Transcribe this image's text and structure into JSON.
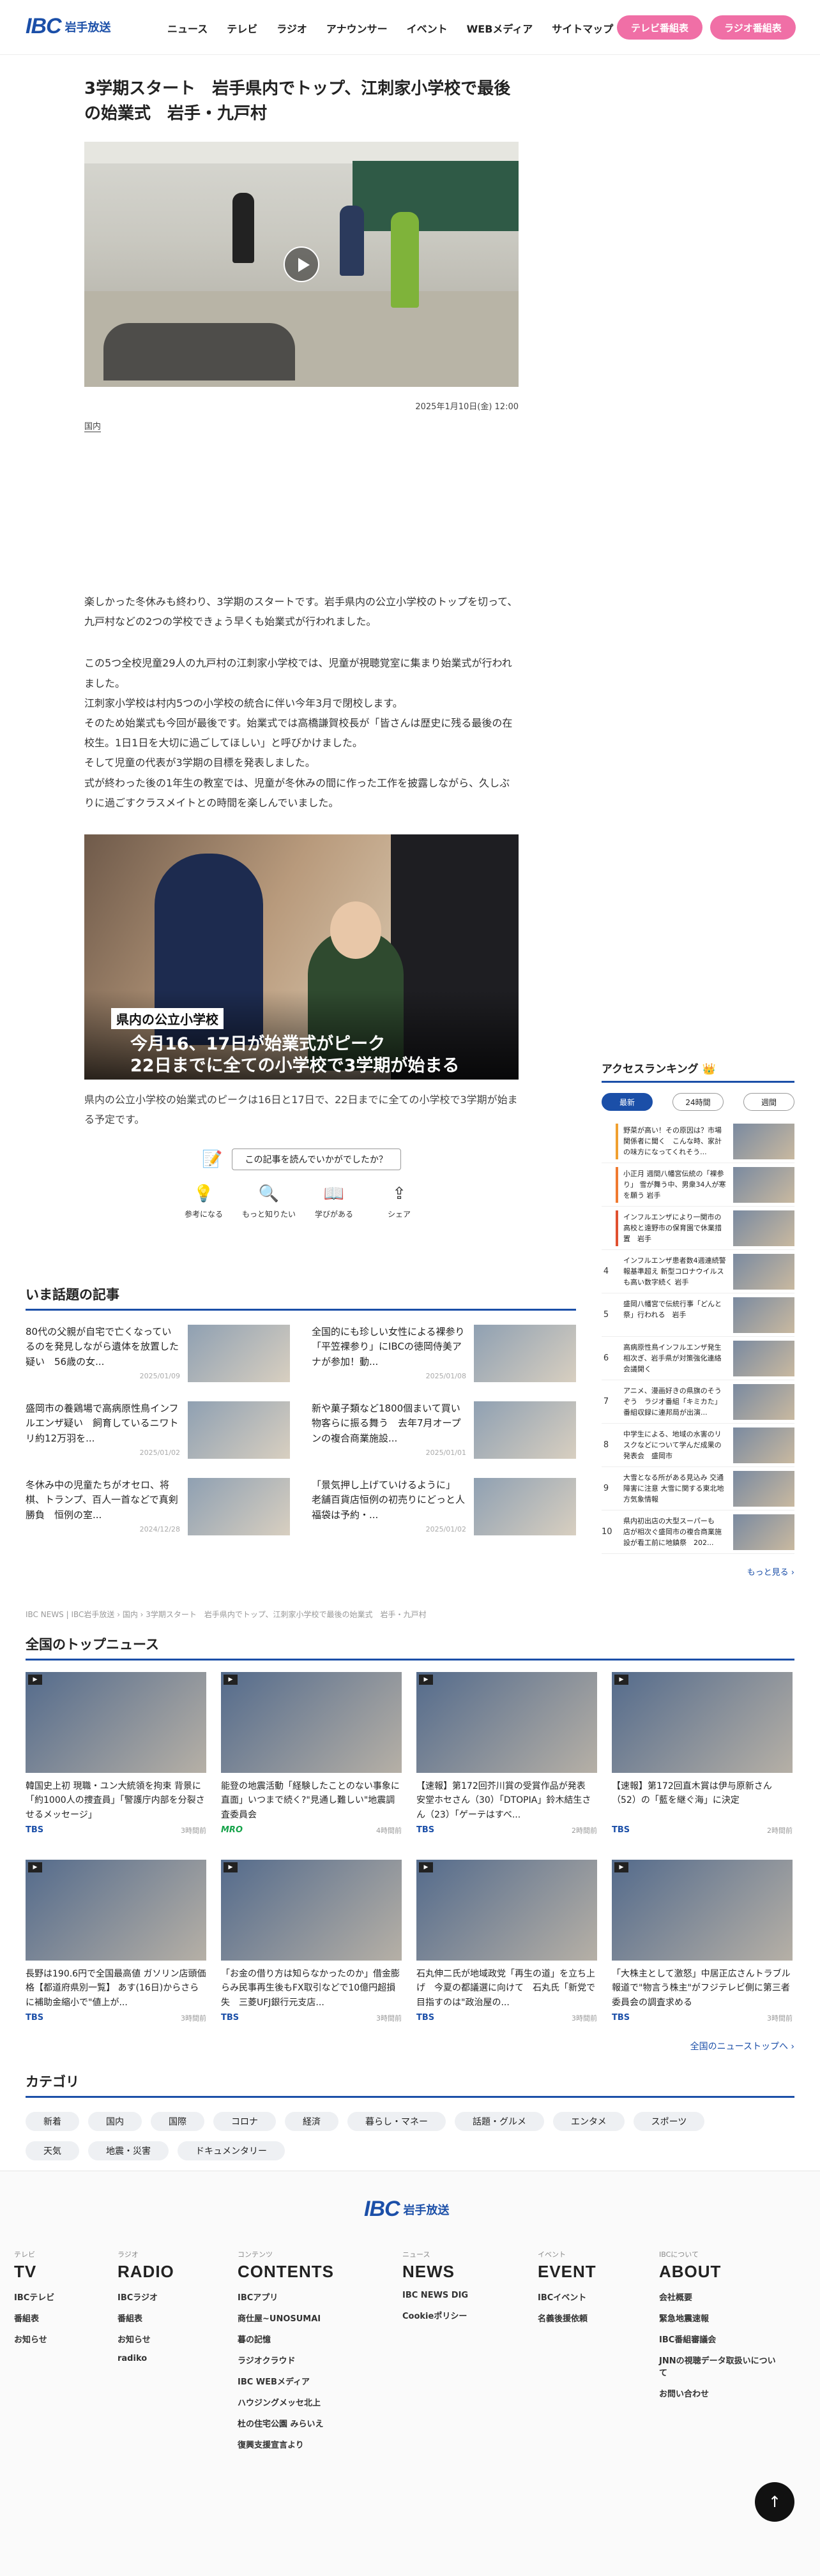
{
  "header": {
    "logo_mark": "IBC",
    "logo_text": "岩手放送",
    "nav": [
      "ニュース",
      "テレビ",
      "ラジオ",
      "アナウンサー",
      "イベント",
      "WEBメディア",
      "サイトマップ"
    ],
    "tv_button": "テレビ番組表",
    "radio_button": "ラジオ番組表"
  },
  "article": {
    "title": "3学期スタート　岩手県内でトップ、江刺家小学校で最後の始業式　岩手・九戸村",
    "date": "2025年1月10日(金) 12:00",
    "category": "国内",
    "paragraphs": [
      "楽しかった冬休みも終わり、3学期のスタートです。岩手県内の公立小学校のトップを切って、九戸村などの2つの学校できょう早くも始業式が行われました。",
      "この5つ全校児童29人の九戸村の江刺家小学校では、児童が視聴覚室に集まり始業式が行われました。\n江刺家小学校は村内5つの小学校の統合に伴い今年3月で閉校します。\nそのため始業式も今回が最後です。始業式では高橋謙賀校長が「皆さんは歴史に残る最後の在校生。1日1日を大切に過ごしてほしい」と呼びかけました。\nそして児童の代表が3学期の目標を発表しました。\n式が終わった後の1年生の教室では、児童が冬休みの間に作った工作を披露しながら、久しぶりに過ごすクラスメイトとの時間を楽しんでいました。"
    ],
    "figure_tag": "県内の公立小学校",
    "figure_line1": "今月16、17日が始業式がピーク",
    "figure_line2": "22日までに全ての小学校で3学期が始まる",
    "figure_caption": "県内の公立小学校の始業式のピークは16日と17日で、22日までに全ての小学校で3学期が始まる予定です。"
  },
  "feedback": {
    "question": "この記事を読んでいかがでしたか？",
    "reactions": [
      {
        "icon": "💡",
        "label": "参考になる"
      },
      {
        "icon": "🔍",
        "label": "もっと知りたい"
      },
      {
        "icon": "📖",
        "label": "学びがある"
      },
      {
        "icon": "⇪",
        "label": "シェア"
      }
    ]
  },
  "ranking": {
    "heading": "アクセスランキング 👑",
    "tabs": [
      "最新",
      "24時間",
      "週間"
    ],
    "items": [
      {
        "num": "",
        "color": "#f0a030",
        "text": "野菜が高い！その原因は？市場関係者に聞く　こんな時、家計の味方になってくれそう..."
      },
      {
        "num": "",
        "color": "#f07a30",
        "text": "小正月 週間八幡宮伝統の「裸参り」 雪が舞う中、男衆34人が寒を願う 岩手"
      },
      {
        "num": "",
        "color": "#e05030",
        "text": "インフルエンザにより一関市の高校と遠野市の保育園で休業措置　岩手"
      },
      {
        "num": "4",
        "color": "#fff",
        "text": "インフルエンザ患者数4週連続警報基準超え 新型コロナウイルスも高い数字続く 岩手"
      },
      {
        "num": "5",
        "color": "#fff",
        "text": "盛岡八幡宮で伝統行事「どんと祭」行われる　岩手"
      },
      {
        "num": "6",
        "color": "#fff",
        "text": "高病原性鳥インフルエンザ発生相次ぎ、岩手県が対策強化連絡会議開く"
      },
      {
        "num": "7",
        "color": "#fff",
        "text": "アニメ、漫画好きの県旗のそうぞう　ラジオ番組「キミカた」番組収録に連邦局が出演..."
      },
      {
        "num": "8",
        "color": "#fff",
        "text": "中学生による、地域の水害のリスクなどについて学んだ成果の発表会　盛岡市"
      },
      {
        "num": "9",
        "color": "#fff",
        "text": "大雪となる所がある見込み 交通障害に注意 大雪に関する東北地方気象情報"
      },
      {
        "num": "10",
        "color": "#fff",
        "text": "県内初出店の大型スーパーも　店が相次ぐ盛岡市の複合商業施設が看工前に地鎮祭　202..."
      }
    ],
    "more": "もっと見る ›"
  },
  "wadai": {
    "heading": "いま話題の記事",
    "items": [
      {
        "title": "80代の父親が自宅で亡くなっているのを発見しながら遺体を放置した疑い　56歳の女...",
        "date": "2025/01/09"
      },
      {
        "title": "全国的にも珍しい女性による裸参り「平笠裸参り」にIBCの徳岡侍美アナが参加！動...",
        "date": "2025/01/08"
      },
      {
        "title": "盛岡市の養鶏場で高病原性鳥インフルエンザ疑い　飼育しているニワトリ約12万羽を...",
        "date": "2025/01/02"
      },
      {
        "title": "新や菓子類など1800個まいて買い物客らに振る舞う　去年7月オープンの複合商業施設...",
        "date": "2025/01/01"
      },
      {
        "title": "冬休み中の児童たちがオセロ、将棋、トランプ、百人一首などで真剣勝負　恒例の室...",
        "date": "2024/12/28"
      },
      {
        "title": "「景気押し上げていけるように」 老舗百貨店恒例の初売りにどっと人　福袋は予約・...",
        "date": "2025/01/02"
      }
    ],
    "breadcrumb": "IBC NEWS | IBC岩手放送 › 国内 › 3学期スタート　岩手県内でトップ、江刺家小学校で最後の始業式　岩手・九戸村"
  },
  "topnews": {
    "heading": "全国のトップニュース",
    "items": [
      {
        "title": "韓国史上初 現職・ユン大統領を拘束 背景に「約1000人の捜査員」「警護庁内部を分裂させるメッセージ」",
        "src": "TBS",
        "time": "3時間前"
      },
      {
        "title": "能登の地震活動「経験したことのない事象に直面」いつまで続く?\"見通し難しい\"地震調査委員会",
        "src": "MRO",
        "time": "4時間前"
      },
      {
        "title": "【速報】第172回芥川賞の受賞作品が発表　安堂ホセさん（30）「DTOPIA」鈴木結生さん（23）「ゲーテはすべ...",
        "src": "TBS",
        "time": "2時間前"
      },
      {
        "title": "【速報】第172回直木賞は伊与原新さん（52）の「藍を継ぐ海」に決定",
        "src": "TBS",
        "time": "2時間前"
      },
      {
        "title": "長野は190.6円で全国最高値 ガソリン店頭価格【都道府県別一覧】 あす(16日)からさらに補助金縮小で\"値上が...",
        "src": "TBS",
        "time": "3時間前"
      },
      {
        "title": "「お金の借り方は知らなかったのか」借金膨らみ民事再生後もFX取引などで10億円超損失　三菱UFJ銀行元支店...",
        "src": "TBS",
        "time": "3時間前"
      },
      {
        "title": "石丸伸二氏が地域政党「再生の道」を立ち上げ　今夏の都議選に向けて　石丸氏「新党で目指すのは\"政治屋の...",
        "src": "TBS",
        "time": "3時間前"
      },
      {
        "title": "「大株主として激怒」中居正広さんトラブル報道で\"物言う株主\"がフジテレビ側に第三者委員会の調査求める",
        "src": "TBS",
        "time": "3時間前"
      }
    ],
    "more": "全国のニューストップへ ›"
  },
  "categories": {
    "heading": "カテゴリ",
    "chips": [
      "新着",
      "国内",
      "国際",
      "コロナ",
      "経済",
      "暮らし・マネー",
      "話題・グルメ",
      "エンタメ",
      "スポーツ",
      "天気",
      "地震・災害",
      "ドキュメンタリー"
    ]
  },
  "footer": {
    "logo_mark": "IBC",
    "logo_text": "岩手放送",
    "columns": [
      {
        "sub": "テレビ",
        "head": "TV",
        "links": [
          "IBCテレビ",
          "番組表",
          "お知らせ"
        ]
      },
      {
        "sub": "ラジオ",
        "head": "RADIO",
        "links": [
          "IBCラジオ",
          "番組表",
          "お知らせ",
          "radiko"
        ]
      },
      {
        "sub": "コンテンツ",
        "head": "CONTENTS",
        "links": [
          "IBCアプリ",
          "商仕屋~UNOSUMAI",
          "暮の記憶",
          "ラジオクラウド",
          "IBC WEBメディア",
          "ハウジングメッセ北上",
          "杜の住宅公園 みらいえ",
          "復興支援宣言より"
        ]
      },
      {
        "sub": "ニュース",
        "head": "NEWS",
        "links": [
          "IBC NEWS DIG",
          "Cookieポリシー"
        ]
      },
      {
        "sub": "イベント",
        "head": "EVENT",
        "links": [
          "IBCイベント",
          "名義後援依頼"
        ]
      },
      {
        "sub": "IBCについて",
        "head": "ABOUT",
        "links": [
          "会社概要",
          "緊急地震速報",
          "IBC番組審議会",
          "JNNの視聴データ取扱いについて",
          "お問い合わせ"
        ]
      }
    ],
    "totop": "↑"
  }
}
